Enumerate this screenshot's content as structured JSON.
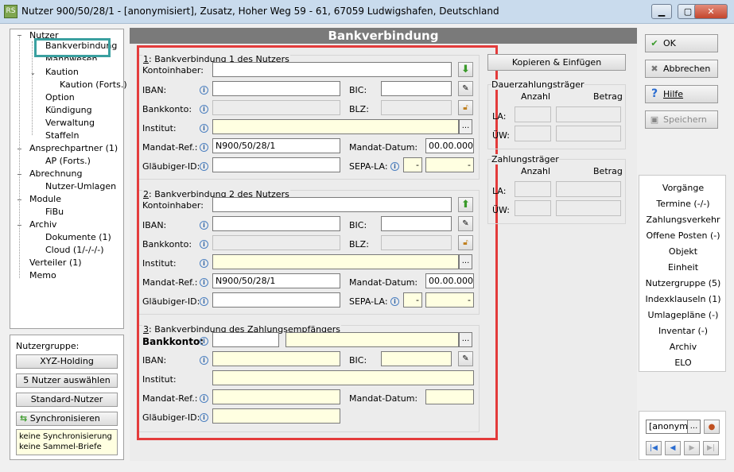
{
  "window": {
    "title": "Nutzer 900/50/28/1 - [anonymisiert], Zusatz, Hoher Weg 59 - 61, 67059 Ludwigshafen, Deutschland",
    "app_icon_text": "RS",
    "minimize": "▁",
    "maximize": "▢",
    "close": "✕"
  },
  "tree": [
    {
      "label": "Nutzer",
      "toggle": "−"
    },
    {
      "label": "Bankverbindung"
    },
    {
      "label": "Mahnwesen"
    },
    {
      "label": "Kaution",
      "toggle": "⌄"
    },
    {
      "label": "Kaution (Forts.)"
    },
    {
      "label": "Option"
    },
    {
      "label": "Kündigung"
    },
    {
      "label": "Verwaltung"
    },
    {
      "label": "Staffeln"
    },
    {
      "label": "Ansprechpartner (1)",
      "toggle": "−"
    },
    {
      "label": "AP (Forts.)"
    },
    {
      "label": "Abrechnung",
      "toggle": "−"
    },
    {
      "label": "Nutzer-Umlagen"
    },
    {
      "label": "Module",
      "toggle": "−"
    },
    {
      "label": "FiBu"
    },
    {
      "label": "Archiv",
      "toggle": "−"
    },
    {
      "label": "Dokumente (1)"
    },
    {
      "label": "Cloud (1/-/-/-)"
    },
    {
      "label": "Verteiler (1)"
    },
    {
      "label": "Memo"
    }
  ],
  "group": {
    "title": "Nutzergruppe:",
    "holding": "XYZ-Holding",
    "select": "5 Nutzer auswählen",
    "standard": "Standard-Nutzer",
    "sync": "Synchronisieren",
    "note1": "keine Synchronisierung",
    "note2": "keine Sammel-Briefe"
  },
  "header": "Bankverbindung",
  "sec1": {
    "title_num": "1",
    "title": ": Bankverbindung 1 des Nutzers",
    "kontoinhaber": "Kontoinhaber:",
    "iban": "IBAN:",
    "bic": "BIC:",
    "bankkonto": "Bankkonto:",
    "blz": "BLZ:",
    "institut": "Institut:",
    "mandat_ref": "Mandat-Ref.:",
    "mandat_ref_value": "N900/50/28/1",
    "mandat_datum": "Mandat-Datum:",
    "mandat_datum_value": "00.00.0000",
    "glaeubiger": "Gläubiger-ID:",
    "sepa": "SEPA-LA:",
    "sepa_a": "-",
    "sepa_b": "-"
  },
  "sec2": {
    "title_num": "2",
    "title": ": Bankverbindung 2 des Nutzers",
    "kontoinhaber": "Kontoinhaber:",
    "iban": "IBAN:",
    "bic": "BIC:",
    "bankkonto": "Bankkonto:",
    "blz": "BLZ:",
    "institut": "Institut:",
    "mandat_ref": "Mandat-Ref.:",
    "mandat_ref_value": "N900/50/28/1",
    "mandat_datum": "Mandat-Datum:",
    "mandat_datum_value": "00.00.0000",
    "glaeubiger": "Gläubiger-ID:",
    "sepa": "SEPA-LA:",
    "sepa_a": "-",
    "sepa_b": "-"
  },
  "sec3": {
    "title_num": "3",
    "title": ": Bankverbindung des Zahlungsempfängers",
    "bankkonto": "Bankkonto:",
    "iban": "IBAN:",
    "bic": "BIC:",
    "institut": "Institut:",
    "mandat_ref": "Mandat-Ref.:",
    "mandat_datum": "Mandat-Datum:",
    "glaeubiger": "Gläubiger-ID:"
  },
  "copy_button": "Kopieren & Einfügen",
  "dauer": {
    "title": "Dauerzahlungsträger",
    "anzahl": "Anzahl",
    "betrag": "Betrag",
    "la": "LA:",
    "uw": "ÜW:"
  },
  "zahlung": {
    "title": "Zahlungsträger",
    "anzahl": "Anzahl",
    "betrag": "Betrag",
    "la": "LA:",
    "uw": "ÜW:"
  },
  "actions": {
    "ok": "OK",
    "cancel": "Abbrechen",
    "help": "Hilfe",
    "save": "Speichern"
  },
  "nav": [
    "Vorgänge",
    "Termine (-/-)",
    "Zahlungsverkehr",
    "Offene Posten (-)",
    "Objekt",
    "Einheit",
    "Nutzergruppe (5)",
    "Indexklauseln (1)",
    "Umlagepläne (-)",
    "Inventar (-)",
    "Archiv",
    "ELO"
  ],
  "nav_box": {
    "field": "[anonymi",
    "ellipsis": "..."
  },
  "accent": "#e33b3b",
  "selection_color": "#3aa0a0"
}
